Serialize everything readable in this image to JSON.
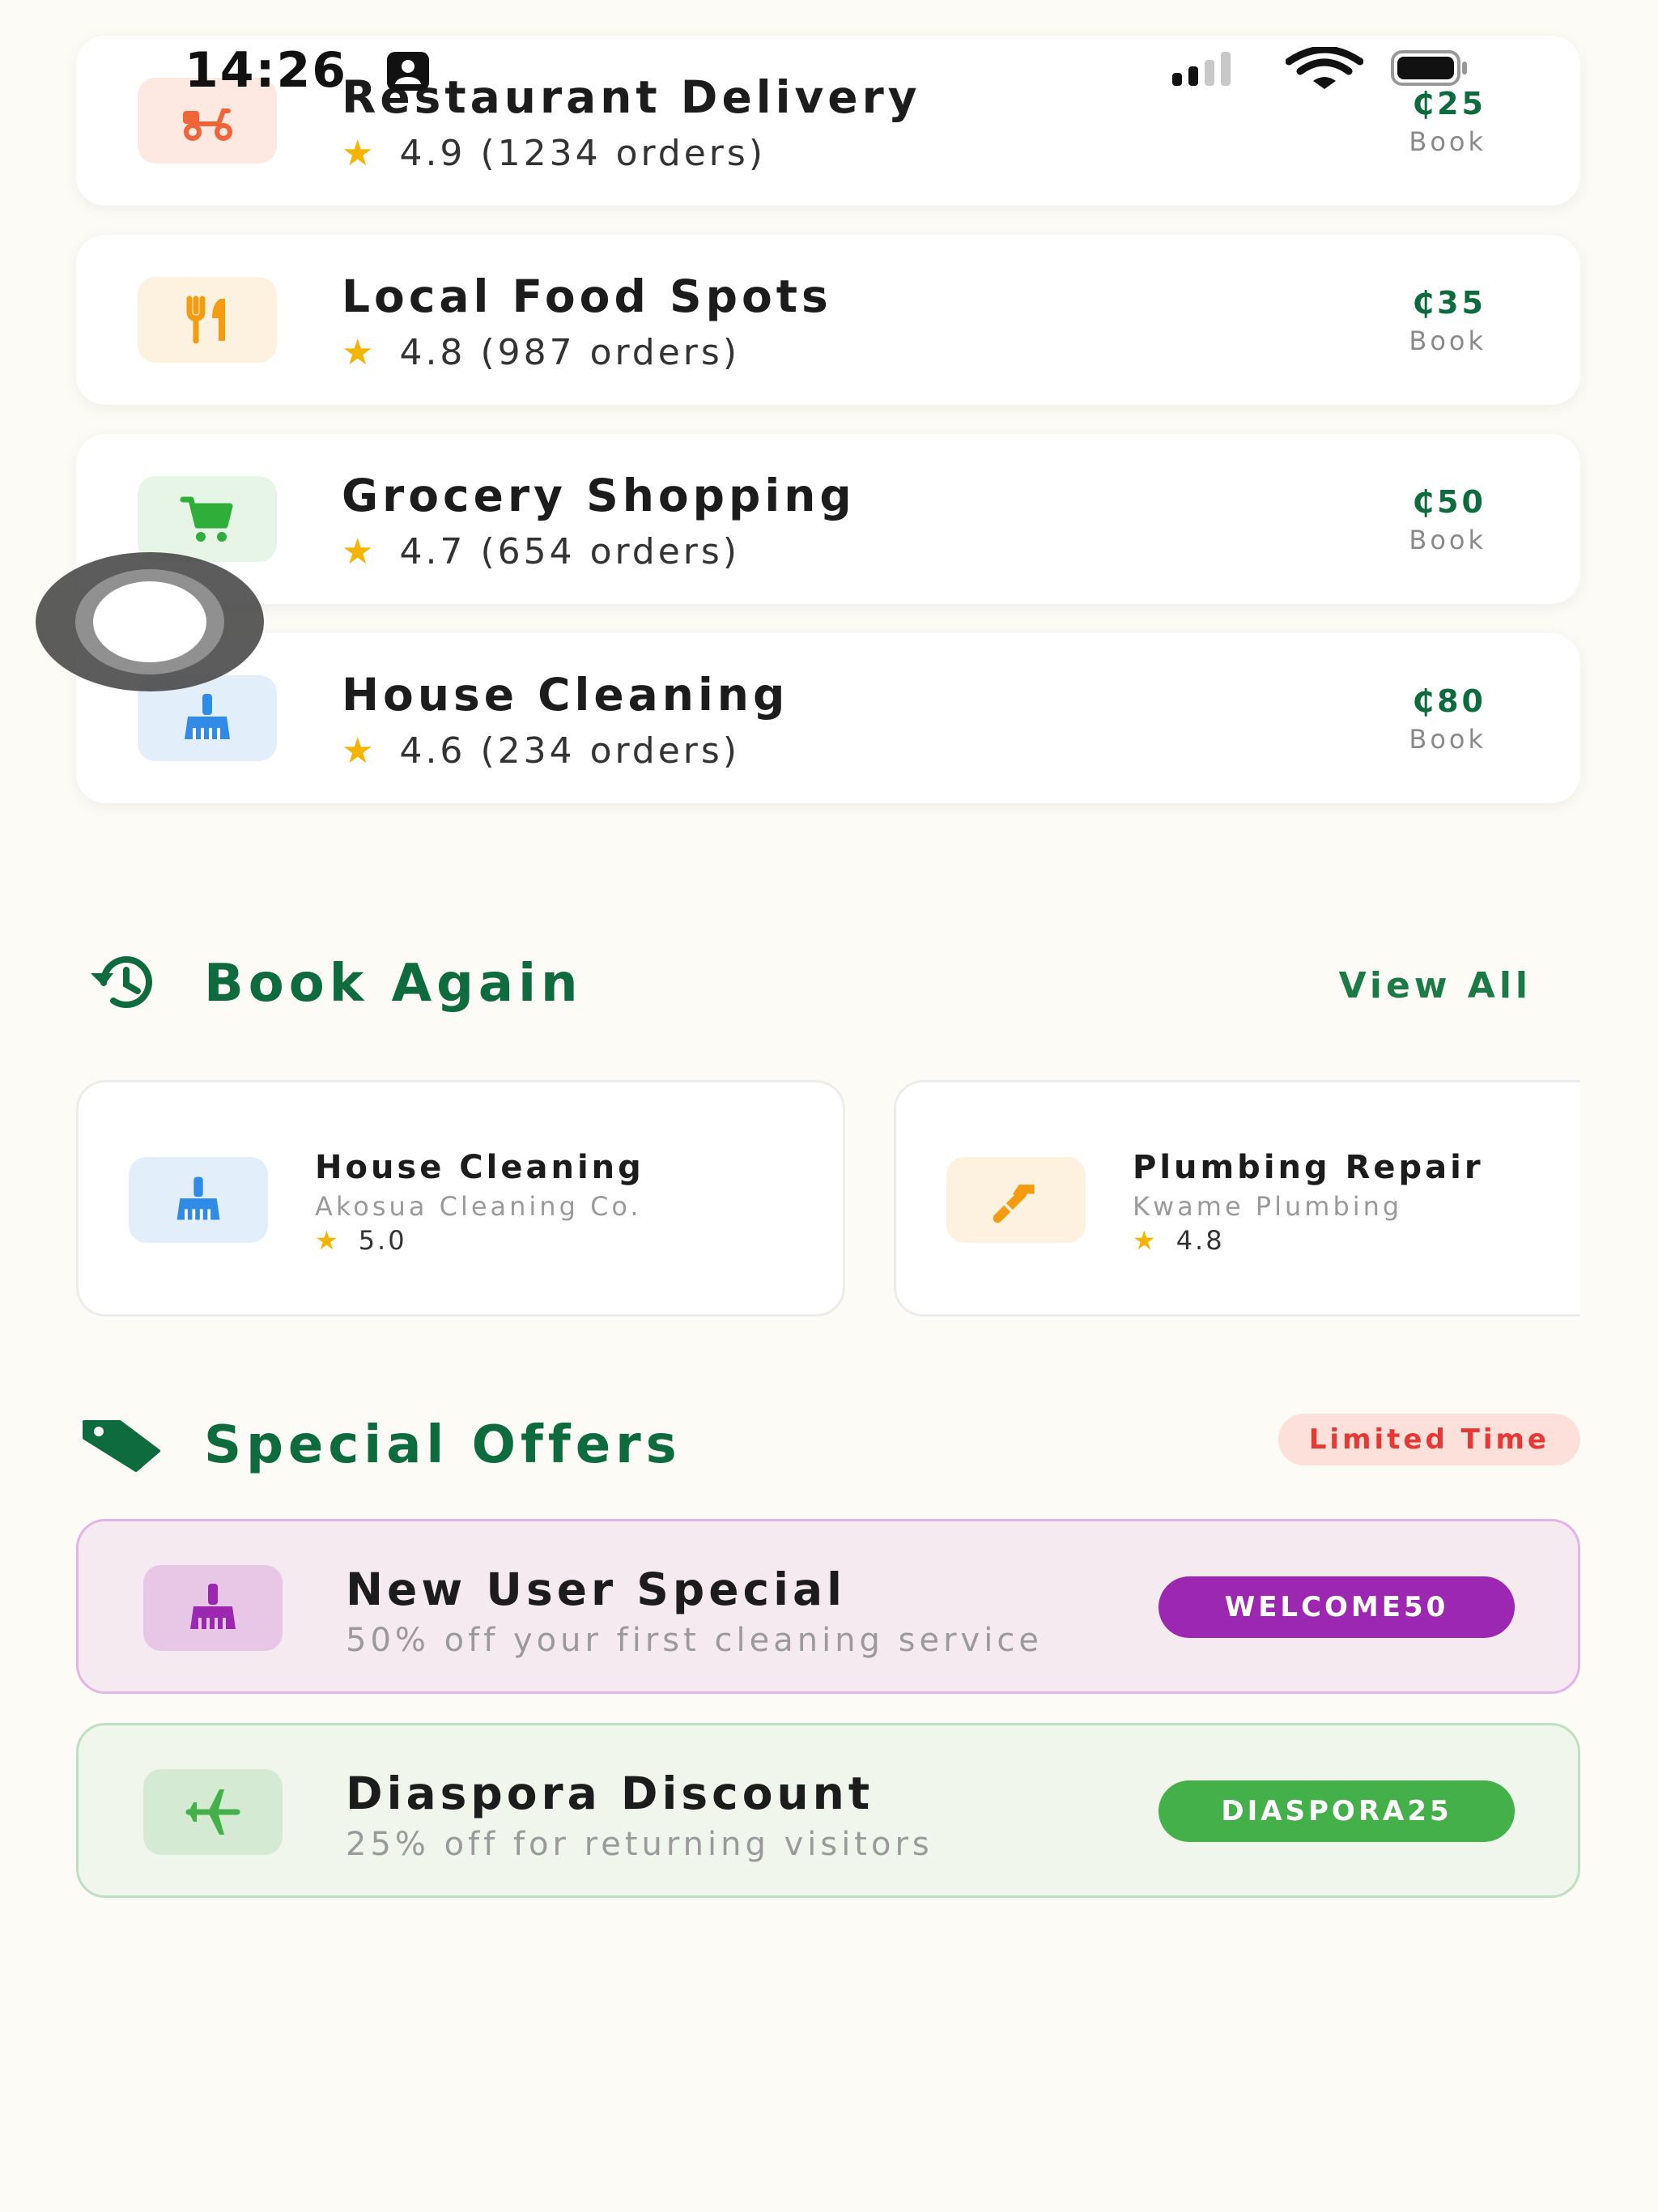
{
  "status_bar": {
    "time": "14:26",
    "person_icon": "person-badge-icon",
    "signal_icon": "cellular-signal-icon",
    "wifi_icon": "wifi-icon",
    "battery_icon": "battery-icon"
  },
  "services": [
    {
      "name": "Restaurant Delivery",
      "rating": "4.9",
      "orders": "(1234 orders)",
      "price": "₵25",
      "book_label": "Book",
      "icon": "scooter-icon",
      "icon_color": "#f0643a",
      "icon_bg": "#fde9e1"
    },
    {
      "name": "Local Food Spots",
      "rating": "4.8",
      "orders": "(987 orders)",
      "price": "₵35",
      "book_label": "Book",
      "icon": "fork-knife-icon",
      "icon_color": "#f39c12",
      "icon_bg": "#fdf1df"
    },
    {
      "name": "Grocery Shopping",
      "rating": "4.7",
      "orders": "(654 orders)",
      "price": "₵50",
      "book_label": "Book",
      "icon": "cart-icon",
      "icon_color": "#2fae3a",
      "icon_bg": "#e6f5e6"
    },
    {
      "name": "House Cleaning",
      "rating": "4.6",
      "orders": "(234 orders)",
      "price": "₵80",
      "book_label": "Book",
      "icon": "broom-icon",
      "icon_color": "#2f8be6",
      "icon_bg": "#e3eefb"
    }
  ],
  "book_again": {
    "title": "Book Again",
    "icon": "history-icon",
    "view_all": "View All",
    "items": [
      {
        "name": "House Cleaning",
        "provider": "Akosua Cleaning Co.",
        "rating": "5.0",
        "icon": "broom-icon",
        "icon_color": "#2f8be6",
        "icon_bg": "#e3eefb"
      },
      {
        "name": "Plumbing Repair",
        "provider": "Kwame Plumbing",
        "rating": "4.8",
        "icon": "wrench-icon",
        "icon_color": "#f39c12",
        "icon_bg": "#fdf1df"
      }
    ]
  },
  "special_offers": {
    "title": "Special Offers",
    "icon": "tag-icon",
    "badge": "Limited Time",
    "offers": [
      {
        "title": "New User Special",
        "description": "50% off your first cleaning service",
        "code": "WELCOME50",
        "icon": "broom-icon",
        "accent": "#9c27b0",
        "icon_bg": "#e8c6e6"
      },
      {
        "title": "Diaspora Discount",
        "description": "25% off for returning visitors",
        "code": "DIASPORA25",
        "icon": "airplane-icon",
        "accent": "#43b049",
        "icon_bg": "#d5ead3"
      }
    ]
  },
  "colors": {
    "brand_green": "#0e6b3e",
    "price_green": "#0e6b3e",
    "star": "#f5b400",
    "badge_red": "#e53935",
    "background": "#fcfbf5"
  }
}
